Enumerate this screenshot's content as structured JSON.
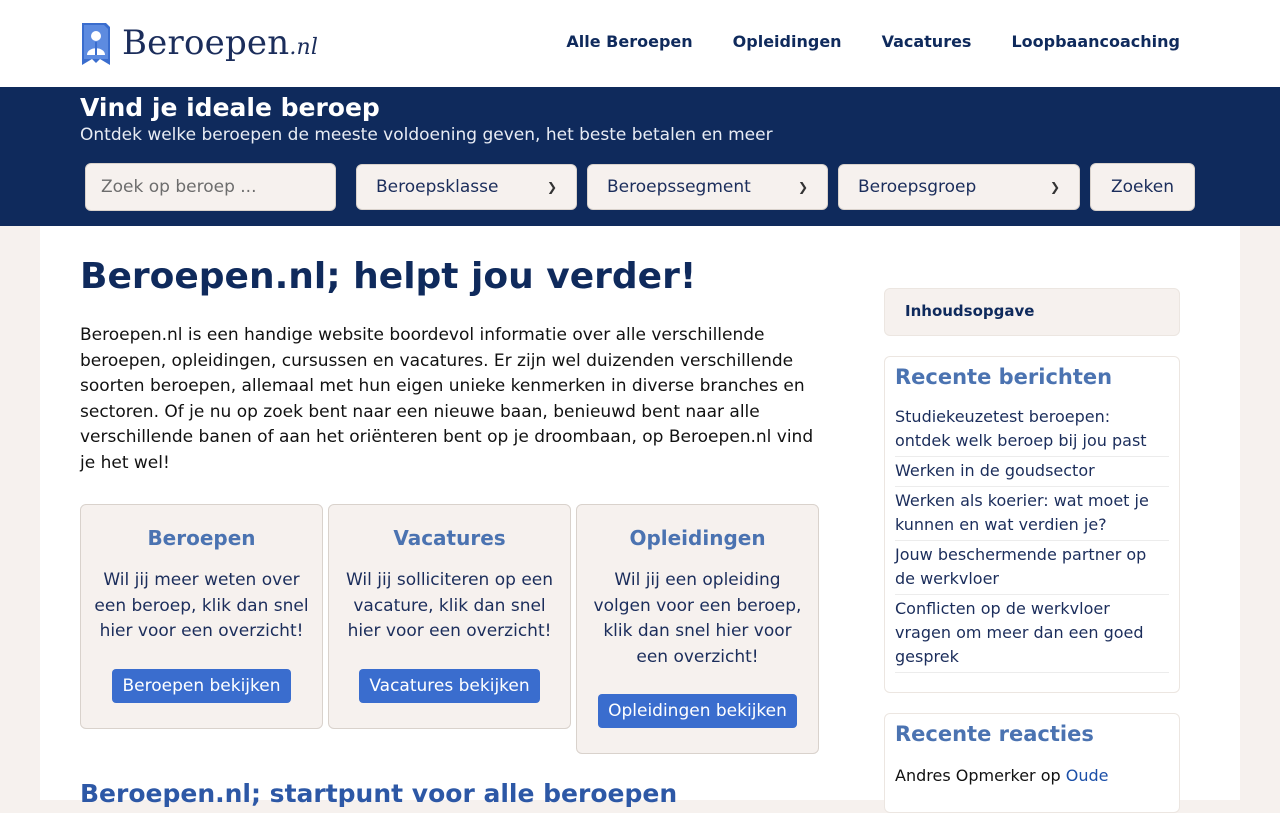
{
  "brand": {
    "name": "Beroepen",
    "tld": ".nl"
  },
  "nav": [
    "Alle Beroepen",
    "Opleidingen",
    "Vacatures",
    "Loopbaancoaching"
  ],
  "hero": {
    "title": "Vind je ideale beroep",
    "subtitle": "Ontdek welke beroepen de meeste voldoening geven, het beste betalen en meer",
    "search_placeholder": "Zoek op beroep ...",
    "selects": [
      "Beroepsklasse",
      "Beroepssegment",
      "Beroepsgroep"
    ],
    "search_button": "Zoeken"
  },
  "main": {
    "title": "Beroepen.nl; helpt jou verder!",
    "intro": "Beroepen.nl is een handige website boordevol informatie over alle verschillende beroepen, opleidingen, cursussen en vacatures. Er zijn wel duizenden verschillende soorten beroepen, allemaal met hun eigen unieke kenmerken in diverse branches en sectoren. Of je nu op zoek bent naar een nieuwe baan, benieuwd bent naar alle verschillende banen of aan het oriënteren bent op je droombaan, op Beroepen.nl vind je het wel!",
    "cards": [
      {
        "title": "Beroepen",
        "text": "Wil jij meer weten over een beroep, klik dan snel hier voor een overzicht!",
        "button": "Beroepen bekijken"
      },
      {
        "title": "Vacatures",
        "text": "Wil jij solliciteren op een vacature, klik dan snel hier voor een overzicht!",
        "button": "Vacatures bekijken"
      },
      {
        "title": "Opleidingen",
        "text": "Wil jij een opleiding volgen voor een beroep, klik dan snel hier voor een overzicht!",
        "button": "Opleidingen bekijken"
      }
    ],
    "section_title": "Beroepen.nl; startpunt voor alle beroepen"
  },
  "sidebar": {
    "toc": "Inhoudsopgave",
    "recent_posts_title": "Recente berichten",
    "recent_posts": [
      "Studiekeuzetest beroepen: ontdek welk beroep bij jou past",
      "Werken in de goudsector",
      "Werken als koerier: wat moet je kunnen en wat verdien je?",
      "Jouw beschermende partner op de werkvloer",
      "Conflicten op de werkvloer vragen om meer dan een goed gesprek"
    ],
    "recent_comments_title": "Recente reacties",
    "comment": {
      "author": "Andres Opmerker",
      "on": "op",
      "post": "Oude"
    }
  },
  "colors": {
    "navy": "#0f2a5c",
    "accent_blue": "#3a6dce",
    "card_title": "#4b73b1",
    "cream": "#f6f1ee"
  }
}
